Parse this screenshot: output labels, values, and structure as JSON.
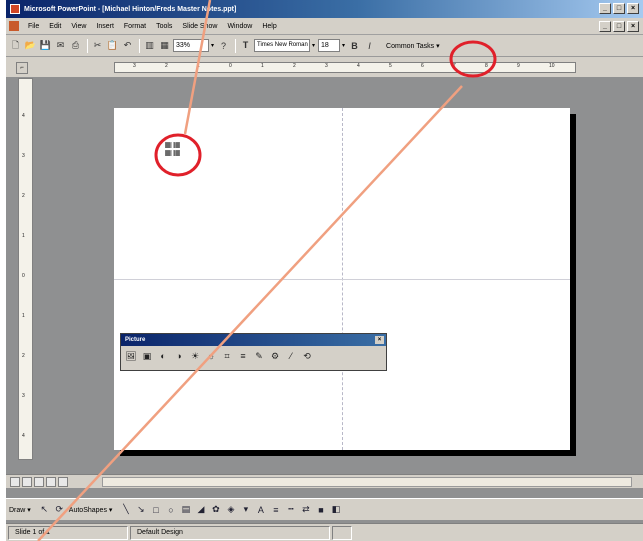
{
  "window": {
    "title": "Microsoft PowerPoint - [Michael Hinton/Freds Master Notes.ppt]",
    "controls": [
      "_",
      "□",
      "×"
    ]
  },
  "menubar": {
    "items": [
      "File",
      "Edit",
      "View",
      "Insert",
      "Format",
      "Tools",
      "Slide Show",
      "Window",
      "Help"
    ]
  },
  "toolbar": {
    "zoom": "33%",
    "font_name": "Times New Roman",
    "font_size": "18",
    "common_tasks": "Common Tasks ▾"
  },
  "ruler": {
    "h_ticks": [
      "3",
      "2",
      "1",
      "0",
      "1",
      "2",
      "3",
      "4",
      "5",
      "6",
      "7",
      "8",
      "9",
      "10"
    ],
    "v_ticks": [
      "4",
      "3",
      "2",
      "1",
      "0",
      "1",
      "2",
      "3",
      "4"
    ]
  },
  "slide": {
    "placeholder_glyph": "▦▦\n▦▦"
  },
  "picture_toolbar": {
    "title": "Picture",
    "close": "×",
    "buttons": [
      "insert-picture-icon",
      "image-control-icon",
      "more-contrast-icon",
      "less-contrast-icon",
      "more-brightness-icon",
      "less-brightness-icon",
      "crop-icon",
      "line-style-icon",
      "recolor-icon",
      "format-picture-icon",
      "set-transparent-icon",
      "reset-picture-icon"
    ]
  },
  "drawing_toolbar": {
    "draw_label": "Draw ▾",
    "autoshapes_label": "AutoShapes ▾"
  },
  "statusbar": {
    "slide": "Slide 1 of 1",
    "design": "Default Design"
  },
  "annotation_color": "#f0a080",
  "circle_color": "#e0202a"
}
